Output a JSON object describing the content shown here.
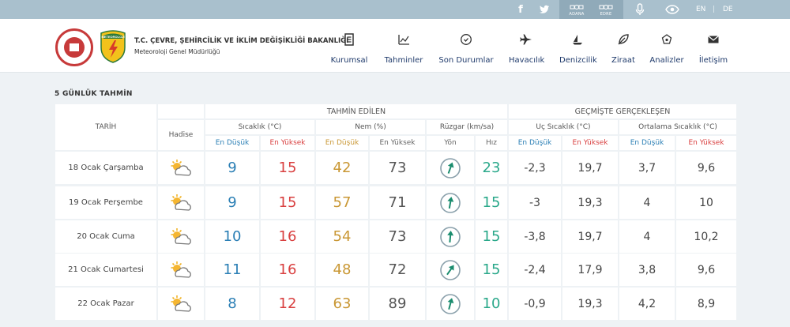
{
  "topbar": {
    "social": [
      "facebook-icon",
      "twitter-icon"
    ],
    "badges": [
      {
        "label": "ADANA",
        "icon": "satellite-icon"
      },
      {
        "label": "EDRE",
        "icon": "satellite-icon"
      }
    ],
    "utilities": [
      "microphone-icon",
      "eye-icon"
    ],
    "languages": [
      "EN",
      "DE"
    ],
    "lang_separator": "|",
    "bar_color": "#a9c0cd"
  },
  "header": {
    "logo2_text": "METEOROLOJİ",
    "org_name": "T.C. ÇEVRE, ŞEHİRCİLİK VE İKLİM DEĞİŞİKLİĞİ BAKANLIĞI",
    "org_sub": "Meteoroloji Genel Müdürlüğü",
    "nav": [
      {
        "label": "Kurumsal",
        "icon": "document-icon"
      },
      {
        "label": "Tahminler",
        "icon": "chart-icon"
      },
      {
        "label": "Son Durumlar",
        "icon": "clock-icon"
      },
      {
        "label": "Havacılık",
        "icon": "airplane-icon"
      },
      {
        "label": "Denizcilik",
        "icon": "sailboat-icon"
      },
      {
        "label": "Ziraat",
        "icon": "leaf-icon"
      },
      {
        "label": "Analizler",
        "icon": "analysis-icon"
      },
      {
        "label": "İletişim",
        "icon": "mail-icon"
      }
    ]
  },
  "section_title": "5 GÜNLÜK TAHMİN",
  "table": {
    "group_forecast": "TAHMİN EDİLEN",
    "group_past": "GEÇMİŞTE GERÇEKLEŞEN",
    "col_date": "TARİH",
    "col_event": "Hadise",
    "sub": {
      "temp": "Sıcaklık (°C)",
      "humidity": "Nem (%)",
      "wind": "Rüzgar (km/sa)",
      "extreme": "Uç Sıcaklık (°C)",
      "average": "Ortalama Sıcaklık (°C)"
    },
    "sub2": {
      "low": "En Düşük",
      "high": "En Yüksek",
      "direction": "Yön",
      "speed": "Hız"
    },
    "rows": [
      {
        "date": "18 Ocak Çarşamba",
        "event_icon": "partly-cloudy-icon",
        "t_low": "9",
        "t_high": "15",
        "h_low": "42",
        "h_high": "73",
        "wind_dir_deg": 20,
        "wind_spd": "23",
        "x_low": "-2,3",
        "x_high": "19,7",
        "a_low": "3,7",
        "a_high": "9,6"
      },
      {
        "date": "19 Ocak Perşembe",
        "event_icon": "partly-cloudy-icon",
        "t_low": "9",
        "t_high": "15",
        "h_low": "57",
        "h_high": "71",
        "wind_dir_deg": 10,
        "wind_spd": "15",
        "x_low": "-3",
        "x_high": "19,3",
        "a_low": "4",
        "a_high": "10"
      },
      {
        "date": "20 Ocak Cuma",
        "event_icon": "partly-cloudy-icon",
        "t_low": "10",
        "t_high": "16",
        "h_low": "54",
        "h_high": "73",
        "wind_dir_deg": 5,
        "wind_spd": "15",
        "x_low": "-3,8",
        "x_high": "19,7",
        "a_low": "4",
        "a_high": "10,2"
      },
      {
        "date": "21 Ocak Cumartesi",
        "event_icon": "partly-cloudy-icon",
        "t_low": "11",
        "t_high": "16",
        "h_low": "48",
        "h_high": "72",
        "wind_dir_deg": 35,
        "wind_spd": "15",
        "x_low": "-2,4",
        "x_high": "17,9",
        "a_low": "3,8",
        "a_high": "9,6"
      },
      {
        "date": "22 Ocak Pazar",
        "event_icon": "partly-cloudy-icon",
        "t_low": "8",
        "t_high": "12",
        "h_low": "63",
        "h_high": "89",
        "wind_dir_deg": 15,
        "wind_spd": "10",
        "x_low": "-0,9",
        "x_high": "19,3",
        "a_low": "4,2",
        "a_high": "8,9"
      }
    ]
  }
}
